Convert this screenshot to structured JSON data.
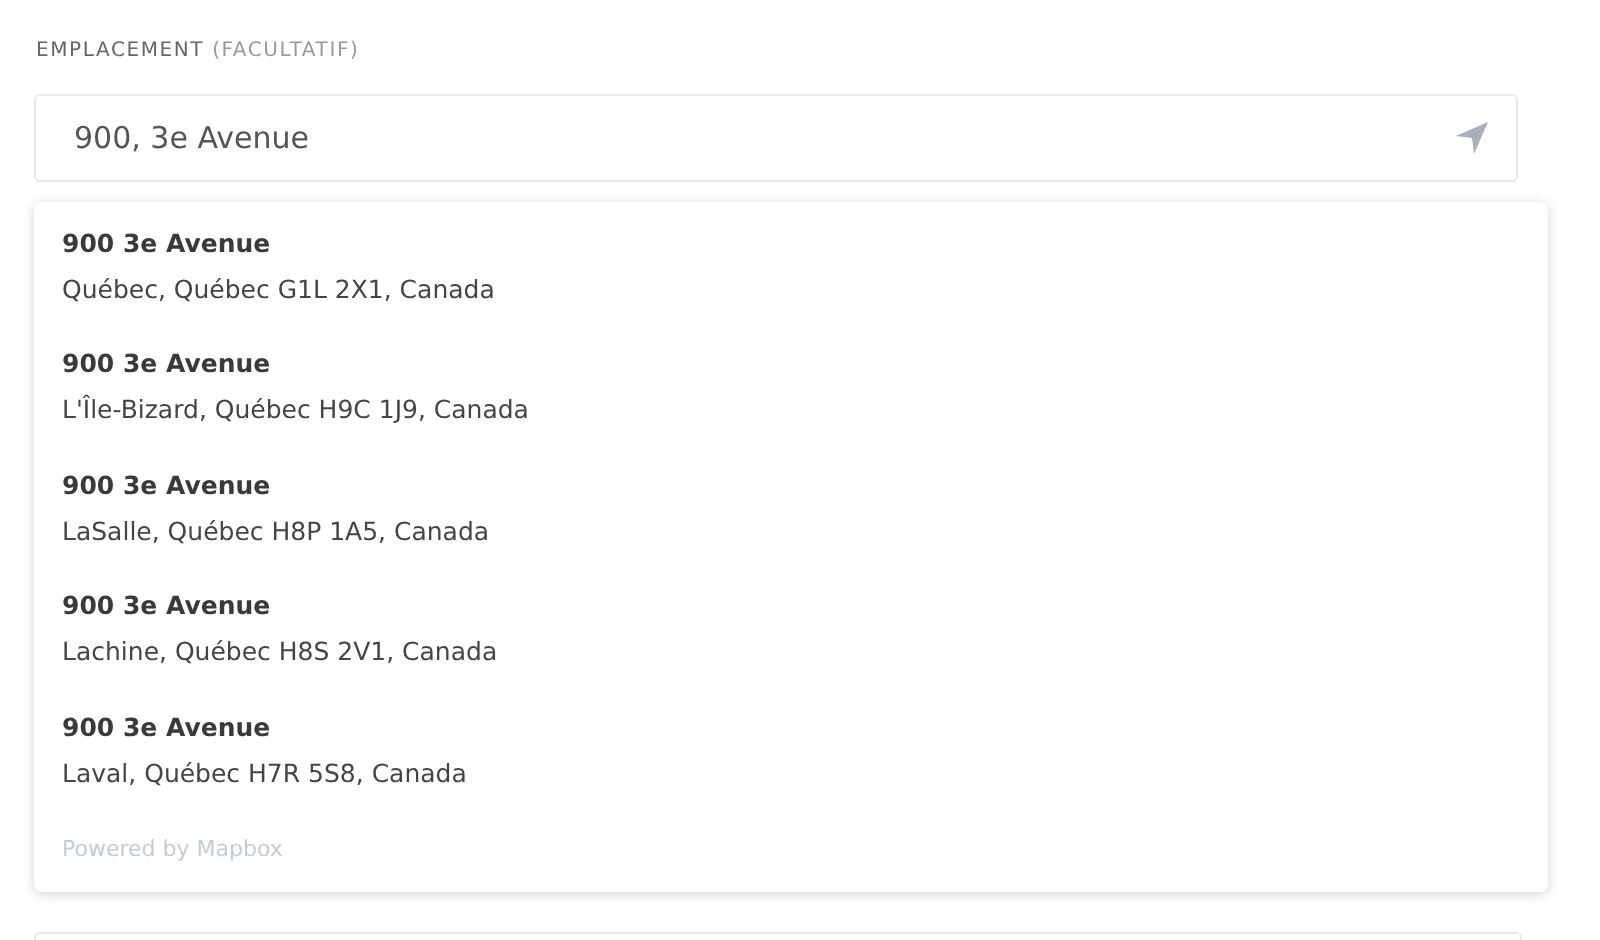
{
  "field": {
    "label": "EMPLACEMENT",
    "label_note": "(FACULTATIF)",
    "value": "900, 3e Avenue"
  },
  "suggestions": [
    {
      "title": "900 3e Avenue",
      "address": "Québec, Québec G1L 2X1, Canada"
    },
    {
      "title": "900 3e Avenue",
      "address": "L'Île-Bizard, Québec H9C 1J9, Canada"
    },
    {
      "title": "900 3e Avenue",
      "address": "LaSalle, Québec H8P 1A5, Canada"
    },
    {
      "title": "900 3e Avenue",
      "address": "Lachine, Québec H8S 2V1, Canada"
    },
    {
      "title": "900 3e Avenue",
      "address": "Laval, Québec H7R 5S8, Canada"
    }
  ],
  "attribution": "Powered by Mapbox"
}
